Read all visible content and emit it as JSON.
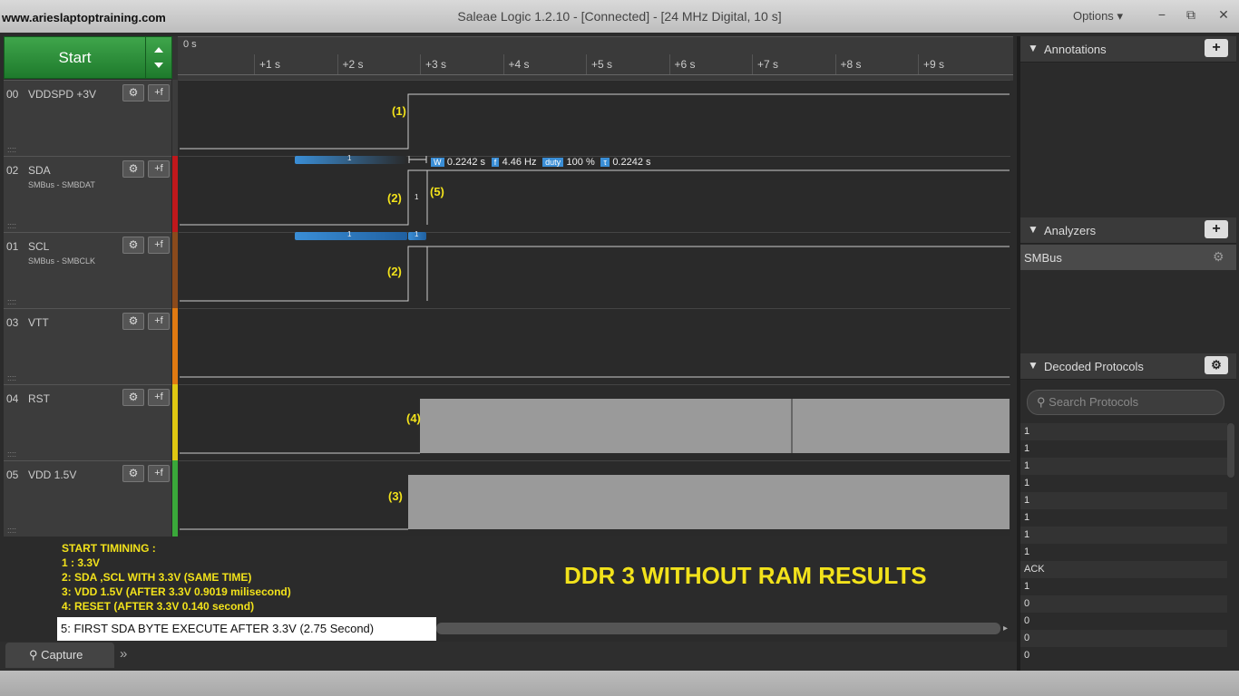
{
  "window": {
    "site": "www.arieslaptoptraining.com",
    "title": "Saleae Logic 1.2.10 - [Connected] - [24 MHz Digital, 10 s]",
    "options": "Options",
    "minimize": "−",
    "restore": "⧉",
    "close": "✕"
  },
  "start": {
    "label": "Start"
  },
  "timeline": {
    "zero": "0 s",
    "ticks": [
      "+1 s",
      "+2 s",
      "+3 s",
      "+4 s",
      "+5 s",
      "+6 s",
      "+7 s",
      "+8 s",
      "+9 s"
    ]
  },
  "channels": [
    {
      "num": "00",
      "name": "VDDSPD +3V",
      "sub": "",
      "color": "#3c3c3c"
    },
    {
      "num": "02",
      "name": "SDA",
      "sub": "SMBus - SMBDAT",
      "color": "#c0181c"
    },
    {
      "num": "01",
      "name": "SCL",
      "sub": "SMBus - SMBCLK",
      "color": "#8a4a1c"
    },
    {
      "num": "03",
      "name": "VTT",
      "sub": "",
      "color": "#e07a12"
    },
    {
      "num": "04",
      "name": "RST",
      "sub": "",
      "color": "#e0c812"
    },
    {
      "num": "05",
      "name": "VDD 1.5V",
      "sub": "",
      "color": "#3aa83a"
    }
  ],
  "icons": {
    "gear": "⚙",
    "add": "+f",
    "grip": "::::"
  },
  "annotations_on_waves": {
    "a1": "(1)",
    "a2_sda": "(2)",
    "a5": "(5)",
    "a2_scl": "(2)",
    "a4": "(4)",
    "a3": "(3)"
  },
  "decoded_bits": {
    "sda_bar": "1",
    "sda_small": "1",
    "scl_bar": "1",
    "scl_small": "1"
  },
  "measurements": {
    "w_tag": "W",
    "w_val": "0.2242 s",
    "f_tag": "f",
    "f_val": "4.46 Hz",
    "duty_tag": "duty",
    "duty_val": "100 %",
    "t_tag": "τ",
    "t_val": "0.2242 s"
  },
  "notes": {
    "heading": "START TIMINING :",
    "l1": "1 :  3.3V",
    "l2": "2:   SDA ,SCL WITH 3.3V (SAME TIME)",
    "l3": "3:  VDD 1.5V (AFTER 3.3V  0.9019 milisecond)",
    "l4": "4:  RESET (AFTER 3.3V  0.140 second)",
    "l5": "5:  FIRST SDA BYTE EXECUTE AFTER 3.3V (2.75 Second)",
    "big": "DDR 3 WITHOUT RAM RESULTS"
  },
  "capture": {
    "label": "Capture",
    "chevrons": "»"
  },
  "right_panel": {
    "annotations": "Annotations",
    "analyzers": "Analyzers",
    "analyzer_item": "SMBus",
    "decoded": "Decoded Protocols",
    "search_placeholder": "Search Protocols",
    "decoded_rows": [
      "1",
      "1",
      "1",
      "1",
      "1",
      "1",
      "1",
      "1",
      "ACK",
      "1",
      "0",
      "0",
      "0",
      "0"
    ]
  }
}
